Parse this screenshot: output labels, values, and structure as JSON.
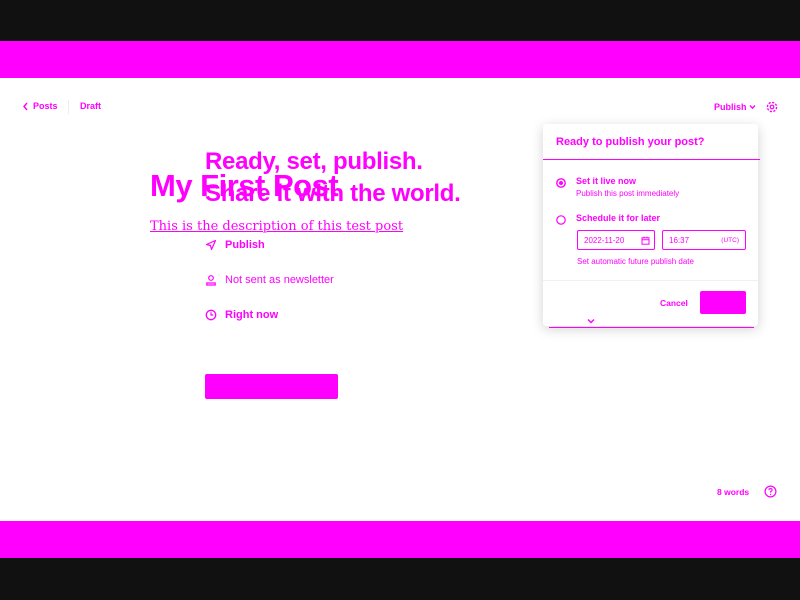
{
  "colors": {
    "accent": "#ff00ff",
    "frame": "#111111",
    "surface": "#ffffff"
  },
  "header": {
    "back_label": "Posts",
    "status_label": "Draft",
    "publish_label": "Publish",
    "settings_icon": "gear-icon"
  },
  "post": {
    "title": "My First Post",
    "description": "This is the description of this test post"
  },
  "flow": {
    "headline_line1": "Ready, set, publish.",
    "headline_line2": "Share it with the world.",
    "options": [
      {
        "icon": "send-icon",
        "label": "Publish"
      },
      {
        "icon": "user-icon",
        "label": "Not sent as newsletter"
      },
      {
        "icon": "clock-icon",
        "label": "Right now"
      }
    ],
    "continue_label": ""
  },
  "popover": {
    "title": "Ready to publish your post?",
    "option_now_label": "Set it live now",
    "option_now_sub": "Publish this post immediately",
    "option_later_label": "Schedule it for later",
    "date_value": "2022-11-20",
    "time_value": "16:37",
    "timezone": "(UTC)",
    "note": "Set automatic future publish date",
    "cancel_label": "Cancel",
    "confirm_label": ""
  },
  "footer": {
    "word_count": "8 words",
    "help_icon": "help-icon"
  }
}
